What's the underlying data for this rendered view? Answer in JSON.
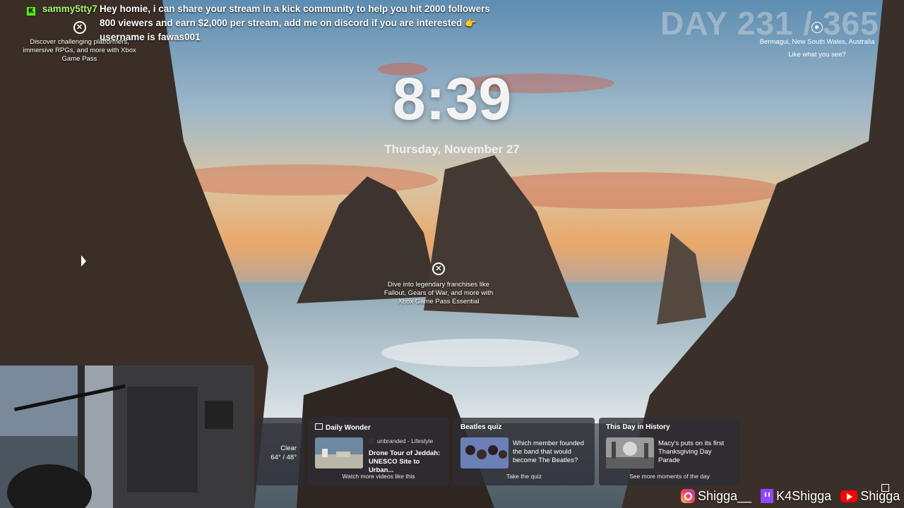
{
  "chat": {
    "platform_icon": "kick-icon",
    "username": "sammy5tty7",
    "message": "Hey homie, i can share your stream in a kick community to help you hit 2000 followers 800 viewers and earn $2,000 per stream, add me on discord if you are interested 👉 username is fawas001"
  },
  "xbox_promo_left": {
    "icon": "xbox-icon",
    "text": "Discover challenging platformers, immersive RPGs, and more with Xbox Game Pass"
  },
  "day_counter": "DAY 231 / 365",
  "location": {
    "icon": "location-pin-icon",
    "place": "Bermagui, New South Wales, Australia",
    "prompt": "Like what you see?"
  },
  "lockscreen": {
    "time": "8:39",
    "date": "Thursday, November 27"
  },
  "xbox_promo_center": {
    "icon": "xbox-icon",
    "text": "Dive into legendary franchises like Fallout, Gears of War, and more with Xbox Game Pass Essential"
  },
  "widgets": {
    "weather": {
      "condition": "Clear",
      "temps": "64° / 48°"
    },
    "daily_wonder": {
      "header": "Daily Wonder",
      "source": "unbranded - Lifestyle",
      "title": "Drone Tour of Jeddah: UNESCO Site to Urban...",
      "footer": "Watch more videos like this"
    },
    "quiz": {
      "header": "Beatles quiz",
      "title": "Which member founded the band that would become The Beatles?",
      "footer": "Take the quiz"
    },
    "history": {
      "header": "This Day in History",
      "title": "Macy's puts on its first Thanksgiving Day Parade",
      "footer": "See more moments of the day"
    }
  },
  "socials": {
    "instagram": "Shigga__",
    "twitch": "K4Shigga",
    "youtube": "Shigga"
  }
}
